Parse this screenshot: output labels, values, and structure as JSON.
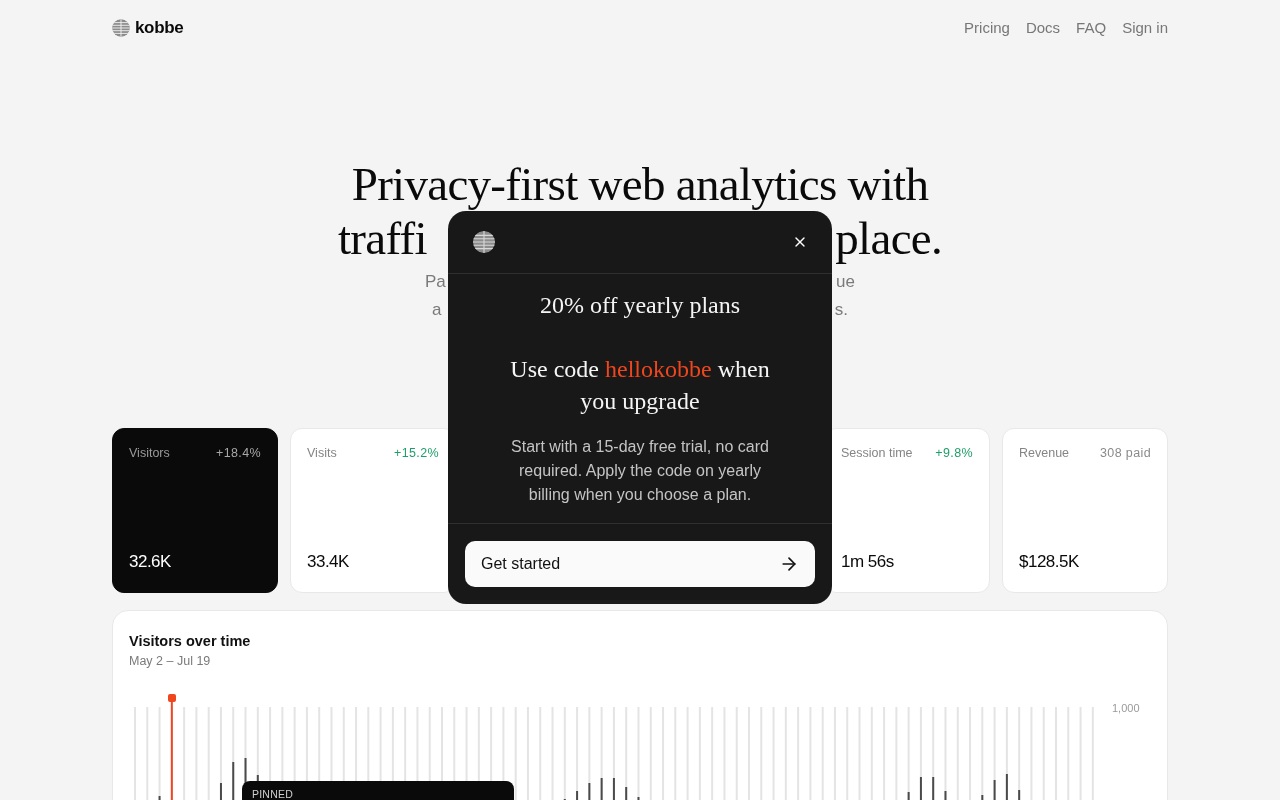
{
  "header": {
    "brand": "kobbe",
    "nav": [
      "Pricing",
      "Docs",
      "FAQ",
      "Sign in"
    ]
  },
  "hero": {
    "headline": [
      [
        "Privacy-first web analytics with"
      ],
      [
        "traffi",
        "place."
      ]
    ],
    "subtitle": [
      [
        "Pa",
        "ue"
      ],
      [
        "a",
        "s."
      ]
    ]
  },
  "stats": [
    {
      "label": "Visitors",
      "delta": {
        "text": "+18.4%",
        "kind": "change"
      },
      "value": "32.6K",
      "selected": true
    },
    {
      "label": "Visits",
      "delta": {
        "text": "+15.2%",
        "kind": "change"
      },
      "value": "33.4K",
      "selected": false
    },
    {
      "label": "Session time",
      "delta": {
        "text": "+9.8%",
        "kind": "change"
      },
      "value": "1m 56s",
      "selected": false
    },
    {
      "label": "Revenue",
      "delta": {
        "text": "308 paid",
        "kind": "count"
      },
      "value": "$128.5K",
      "selected": false
    }
  ],
  "chart_panel": {
    "title": "Visitors over time",
    "subtitle": "May 2 – Jul 19",
    "axis_label": "1,000",
    "tooltip": {
      "label": "PINNED"
    }
  },
  "dialog": {
    "title": "20% off yearly plans",
    "message": {
      "before": "Use code",
      "code": "hellokobbe",
      "after": "when you upgrade"
    },
    "body": "Start with a 15-day free trial, no card required. Apply the code on yearly billing when you choose a plan.",
    "button": "Get started"
  }
}
